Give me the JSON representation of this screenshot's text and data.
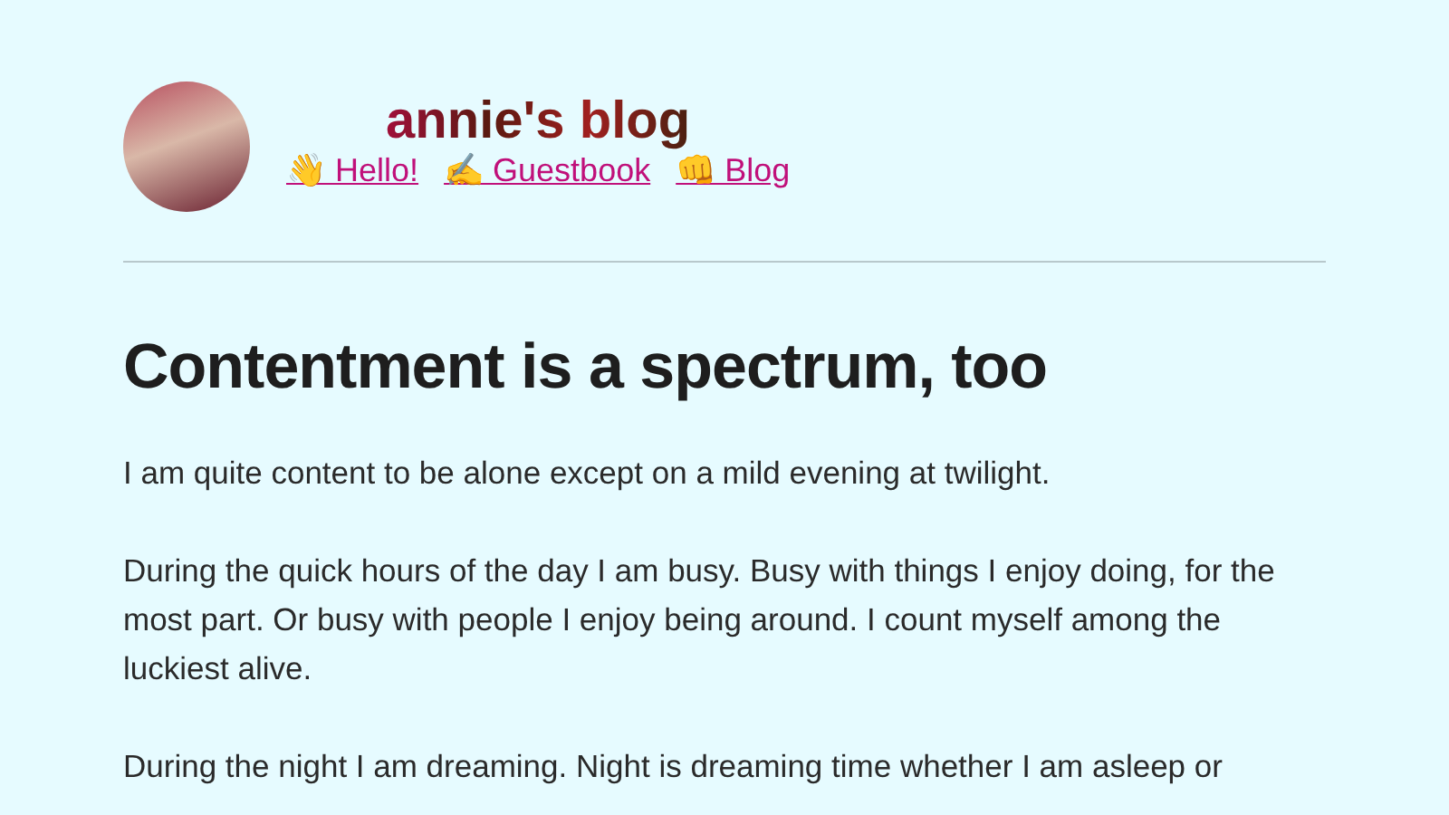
{
  "header": {
    "title": "annie's blog",
    "nav": [
      {
        "label": "👋 Hello!"
      },
      {
        "label": "✍️ Guestbook"
      },
      {
        "label": "👊 Blog"
      }
    ]
  },
  "post": {
    "title": "Contentment is a spectrum, too",
    "paragraphs": [
      "I am quite content to be alone except on a mild evening at twilight.",
      "During the quick hours of the day I am busy. Busy with things I enjoy doing, for the most part. Or busy with people I enjoy being around. I count myself among the luckiest alive.",
      "During the night I am dreaming. Night is dreaming time whether I am asleep or"
    ]
  }
}
